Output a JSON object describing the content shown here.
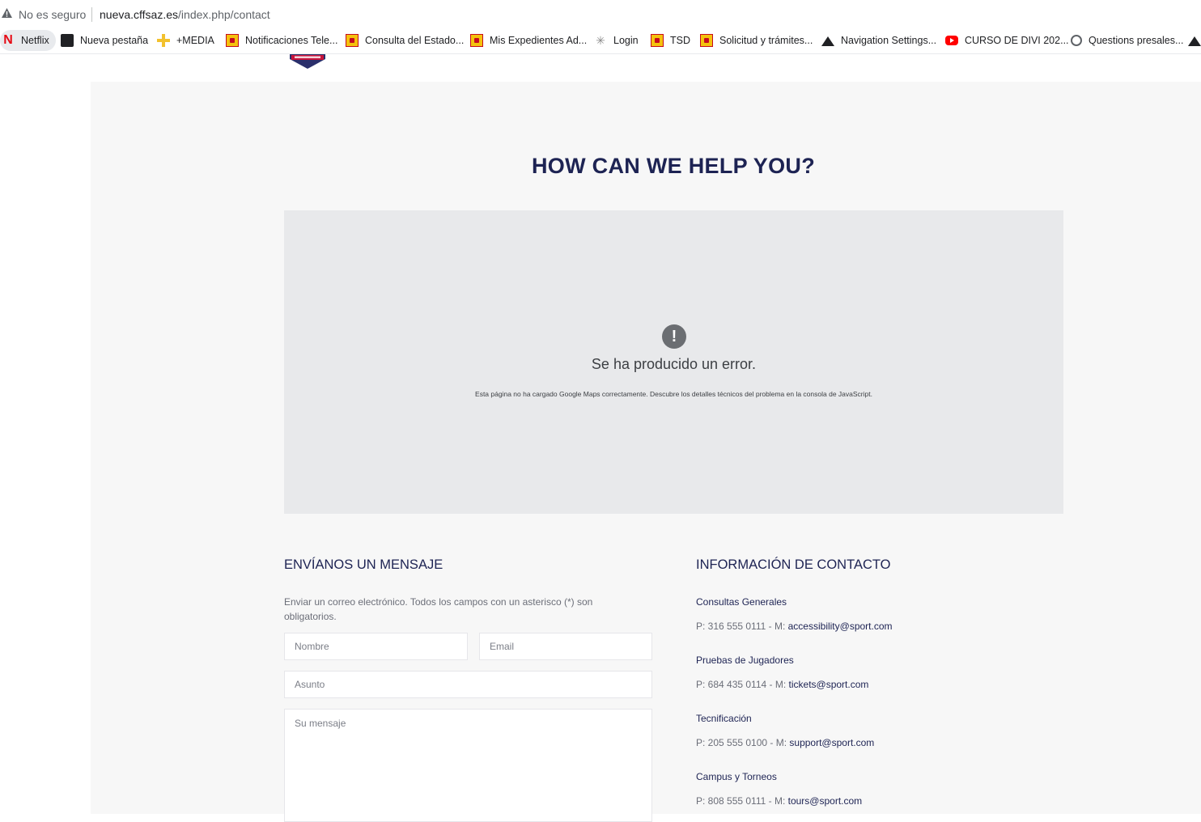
{
  "browser": {
    "security_text": "No es seguro",
    "url_host": "nueva.cffsaz.es",
    "url_path": "/index.php/contact",
    "bookmarks": [
      {
        "label": "Netflix",
        "icon": "netflix-icon"
      },
      {
        "label": "Nueva pestaña",
        "icon": "new-tab-icon"
      },
      {
        "label": "+MEDIA",
        "icon": "plus-icon"
      },
      {
        "label": "Notificaciones Tele...",
        "icon": "spain-flag-icon"
      },
      {
        "label": "Consulta del Estado...",
        "icon": "spain-flag-icon"
      },
      {
        "label": "Mis Expedientes Ad...",
        "icon": "spain-flag-icon"
      },
      {
        "label": "Login",
        "icon": "loading-icon"
      },
      {
        "label": "TSD",
        "icon": "spain-flag-icon"
      },
      {
        "label": "Solicitud y trámites...",
        "icon": "spain-flag-icon"
      },
      {
        "label": "Navigation Settings...",
        "icon": "triangle-logo-icon"
      },
      {
        "label": "CURSO DE DIVI 202...",
        "icon": "youtube-icon"
      },
      {
        "label": "Questions presales...",
        "icon": "globe-icon"
      }
    ]
  },
  "page": {
    "heading": "HOW CAN WE HELP YOU?",
    "map_error": {
      "title": "Se ha producido un error.",
      "description": "Esta página no ha cargado Google Maps correctamente. Descubre los detalles técnicos del problema en la consola de JavaScript."
    },
    "form": {
      "title": "ENVÍANOS UN MENSAJE",
      "intro": "Enviar un correo electrónico. Todos los campos con un asterisco (*) son obligatorios.",
      "name_placeholder": "Nombre",
      "email_placeholder": "Email",
      "subject_placeholder": "Asunto",
      "message_placeholder": "Su mensaje"
    },
    "contact": {
      "title": "INFORMACIÓN DE CONTACTO",
      "items": [
        {
          "label": "Consultas Generales",
          "phone_prefix": "P: 316 555 0111 - M: ",
          "email": "accessibility@sport.com"
        },
        {
          "label": "Pruebas de Jugadores",
          "phone_prefix": "P: 684 435 0114 - M: ",
          "email": "tickets@sport.com"
        },
        {
          "label": "Tecnificación",
          "phone_prefix": "P: 205 555 0100 - M: ",
          "email": "support@sport.com"
        },
        {
          "label": "Campus y Torneos",
          "phone_prefix": "P: 808 555 0111 - M: ",
          "email": "tours@sport.com"
        }
      ]
    }
  },
  "colors": {
    "heading": "#1d2353",
    "content_bg": "#f7f7f7",
    "map_bg": "#e8e9eb"
  }
}
